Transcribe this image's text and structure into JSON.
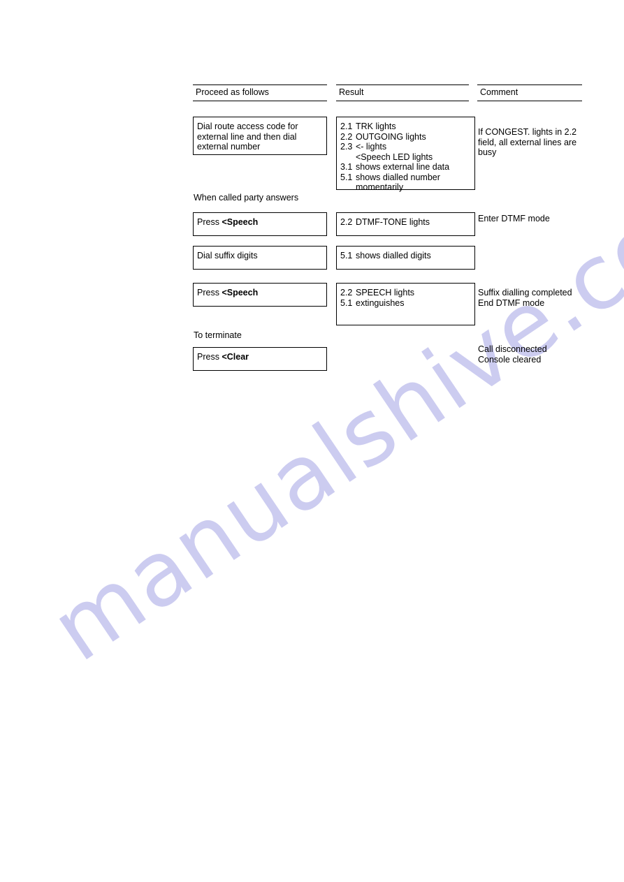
{
  "watermark": {
    "text": "manualshive.com",
    "color": "#ccccf0"
  },
  "table": {
    "headers": [
      "Proceed as follows",
      "Result",
      "Comment"
    ],
    "captions": [
      "When called party answers",
      "To terminate"
    ],
    "rows": [
      {
        "action": [
          "Dial route access code for",
          "external line and then dial",
          "external number"
        ],
        "result": [
          {
            "num": "2.1",
            "txt": "TRK lights"
          },
          {
            "num": "2.2",
            "txt": "OUTGOING lights"
          },
          {
            "num": "2.3",
            "txt": "<- lights"
          },
          {
            "num": "",
            "txt": "<Speech LED lights"
          },
          {
            "num": "3.1",
            "txt": "shows external line data"
          },
          {
            "num": "5.1",
            "txt": "shows dialled number"
          },
          {
            "num": "",
            "txt": "momentarily"
          }
        ],
        "comment": [
          "If CONGEST. lights in 2.2",
          "field, all external lines are",
          "busy"
        ]
      },
      {
        "action_prefix": "Press",
        "action_key": "<Speech",
        "result": [
          {
            "num": "2.2",
            "txt": "DTMF-TONE lights"
          }
        ],
        "comment": [
          "Enter DTMF mode"
        ]
      },
      {
        "action": [
          "Dial suffix digits"
        ],
        "result": [
          {
            "num": "5.1",
            "txt": "shows dialled digits"
          }
        ],
        "comment": []
      },
      {
        "action_prefix": "Press",
        "action_key": "<Speech",
        "result": [
          {
            "num": "2.2",
            "txt": "SPEECH lights"
          },
          {
            "num": "5.1",
            "txt": "extinguishes"
          }
        ],
        "comment": [
          "Suffix dialling completed",
          "End DTMF mode"
        ]
      },
      {
        "action_prefix": "Press",
        "action_key": "<Clear",
        "result": [],
        "comment": [
          "Call disconnected",
          "Console cleared"
        ]
      }
    ]
  }
}
